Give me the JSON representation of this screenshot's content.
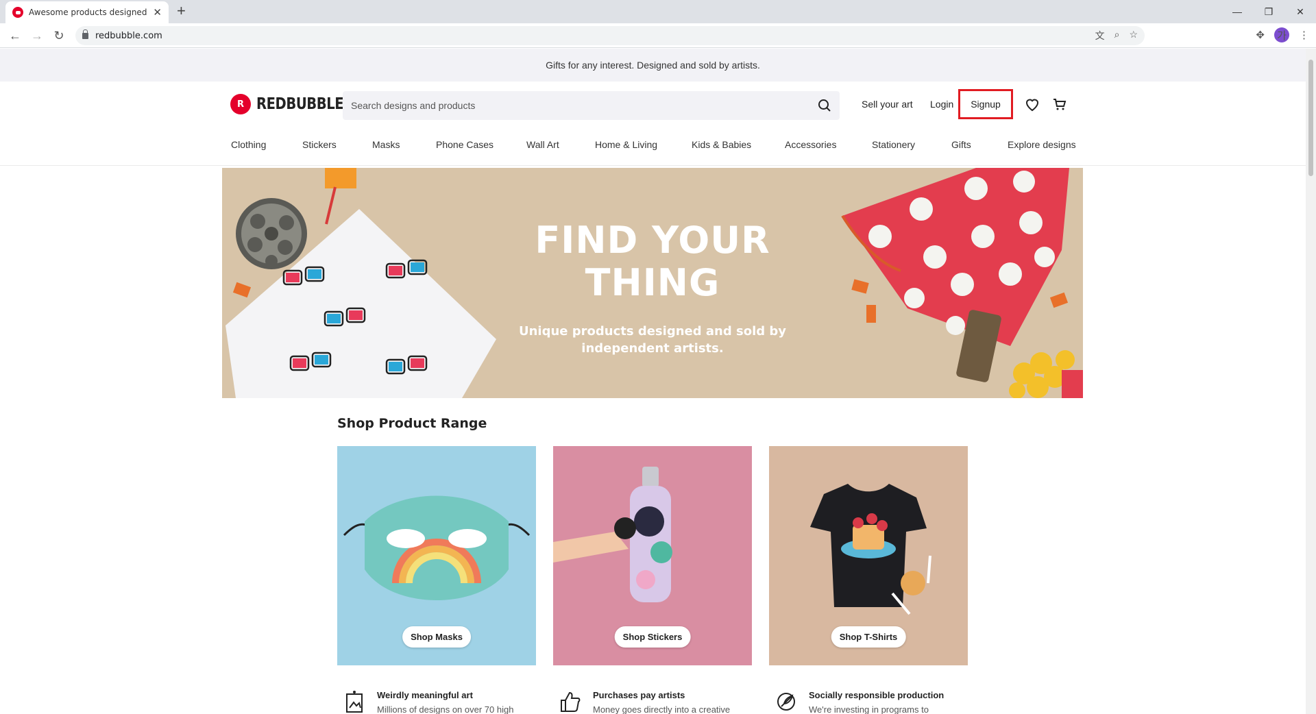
{
  "browser": {
    "tab_title": "Awesome products designed by",
    "url": "redbubble.com"
  },
  "announcement": "Gifts for any interest. Designed and sold by artists.",
  "header": {
    "logo_text": "REDBUBBLE",
    "search_placeholder": "Search designs and products",
    "sell_label": "Sell your art",
    "login_label": "Login",
    "signup_label": "Signup"
  },
  "categories": [
    "Clothing",
    "Stickers",
    "Masks",
    "Phone Cases",
    "Wall Art",
    "Home & Living",
    "Kids & Babies",
    "Accessories",
    "Stationery",
    "Gifts",
    "Explore designs"
  ],
  "hero": {
    "title_line1": "FIND YOUR",
    "title_line2": "THING",
    "subtitle_line1": "Unique products designed and sold by",
    "subtitle_line2": "independent artists."
  },
  "product_range": {
    "title": "Shop Product Range",
    "cards": [
      {
        "label": "Shop Masks",
        "color": "#9fd2e6"
      },
      {
        "label": "Shop Stickers",
        "color": "#d98ea2"
      },
      {
        "label": "Shop T-Shirts",
        "color": "#d8b8a0"
      }
    ]
  },
  "features": [
    {
      "title": "Weirdly meaningful art",
      "desc": "Millions of designs on over 70 high",
      "icon": "art-frame-icon"
    },
    {
      "title": "Purchases pay artists",
      "desc": "Money goes directly into a creative",
      "icon": "thumbs-up-icon"
    },
    {
      "title": "Socially responsible production",
      "desc": "We're investing in programs to",
      "icon": "leaf-icon"
    }
  ],
  "colors": {
    "brand": "#e4002b",
    "highlight": "#e11b22"
  }
}
